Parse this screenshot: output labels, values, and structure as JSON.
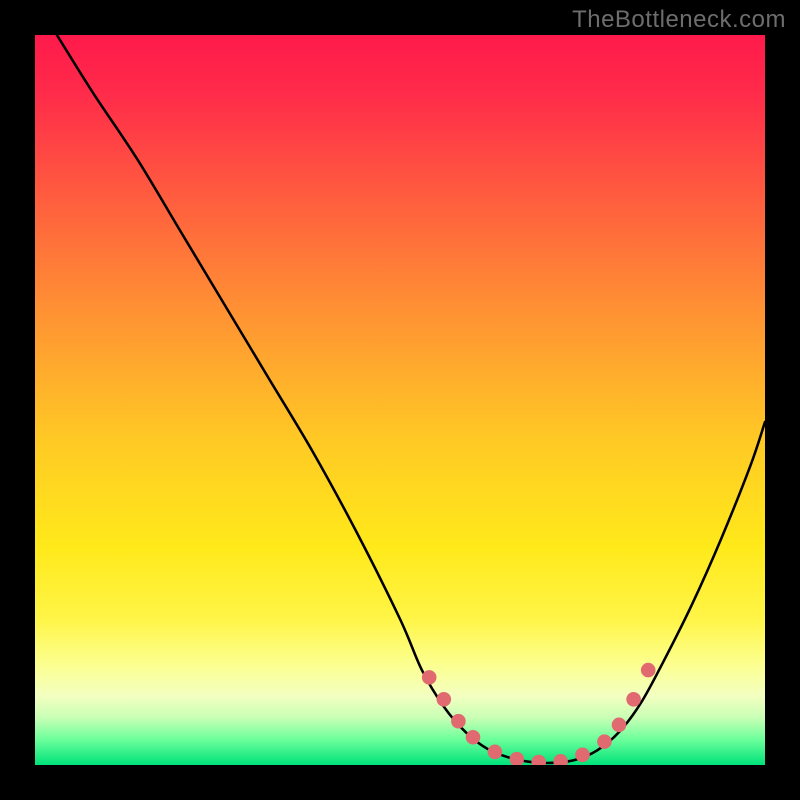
{
  "watermark": "TheBottleneck.com",
  "gradient_stops": [
    {
      "offset": 0,
      "color": "#ff1a4b"
    },
    {
      "offset": 0.08,
      "color": "#ff2b4a"
    },
    {
      "offset": 0.22,
      "color": "#ff5c3f"
    },
    {
      "offset": 0.38,
      "color": "#ff9233"
    },
    {
      "offset": 0.55,
      "color": "#ffc825"
    },
    {
      "offset": 0.7,
      "color": "#ffe91a"
    },
    {
      "offset": 0.8,
      "color": "#fff547"
    },
    {
      "offset": 0.86,
      "color": "#fcff8d"
    },
    {
      "offset": 0.905,
      "color": "#f3ffc0"
    },
    {
      "offset": 0.935,
      "color": "#c9ffb5"
    },
    {
      "offset": 0.965,
      "color": "#6cff9b"
    },
    {
      "offset": 1.0,
      "color": "#00e27a"
    }
  ],
  "marker_color": "#e06a6f",
  "curve_color": "#000000",
  "chart_data": {
    "type": "line",
    "title": "",
    "xlabel": "",
    "ylabel": "",
    "xlim": [
      0,
      100
    ],
    "ylim": [
      0,
      100
    ],
    "series": [
      {
        "name": "curve",
        "x": [
          3,
          8,
          14,
          20,
          26,
          32,
          38,
          44,
          50,
          53,
          56,
          59,
          62,
          65,
          68,
          71,
          74,
          77,
          80,
          83,
          86,
          90,
          94,
          98,
          100
        ],
        "y": [
          100,
          92,
          83,
          73,
          63,
          53,
          43,
          32,
          20,
          13,
          8,
          4.5,
          2.2,
          1.0,
          0.4,
          0.3,
          0.7,
          2.0,
          4.5,
          8.5,
          14,
          22,
          31,
          41,
          47
        ]
      }
    ],
    "markers": {
      "name": "dots",
      "x": [
        54,
        56,
        58,
        60,
        63,
        66,
        69,
        72,
        75,
        78,
        80,
        82,
        84
      ],
      "y": [
        12,
        9,
        6,
        3.8,
        1.8,
        0.8,
        0.4,
        0.5,
        1.4,
        3.2,
        5.5,
        9,
        13
      ]
    }
  }
}
